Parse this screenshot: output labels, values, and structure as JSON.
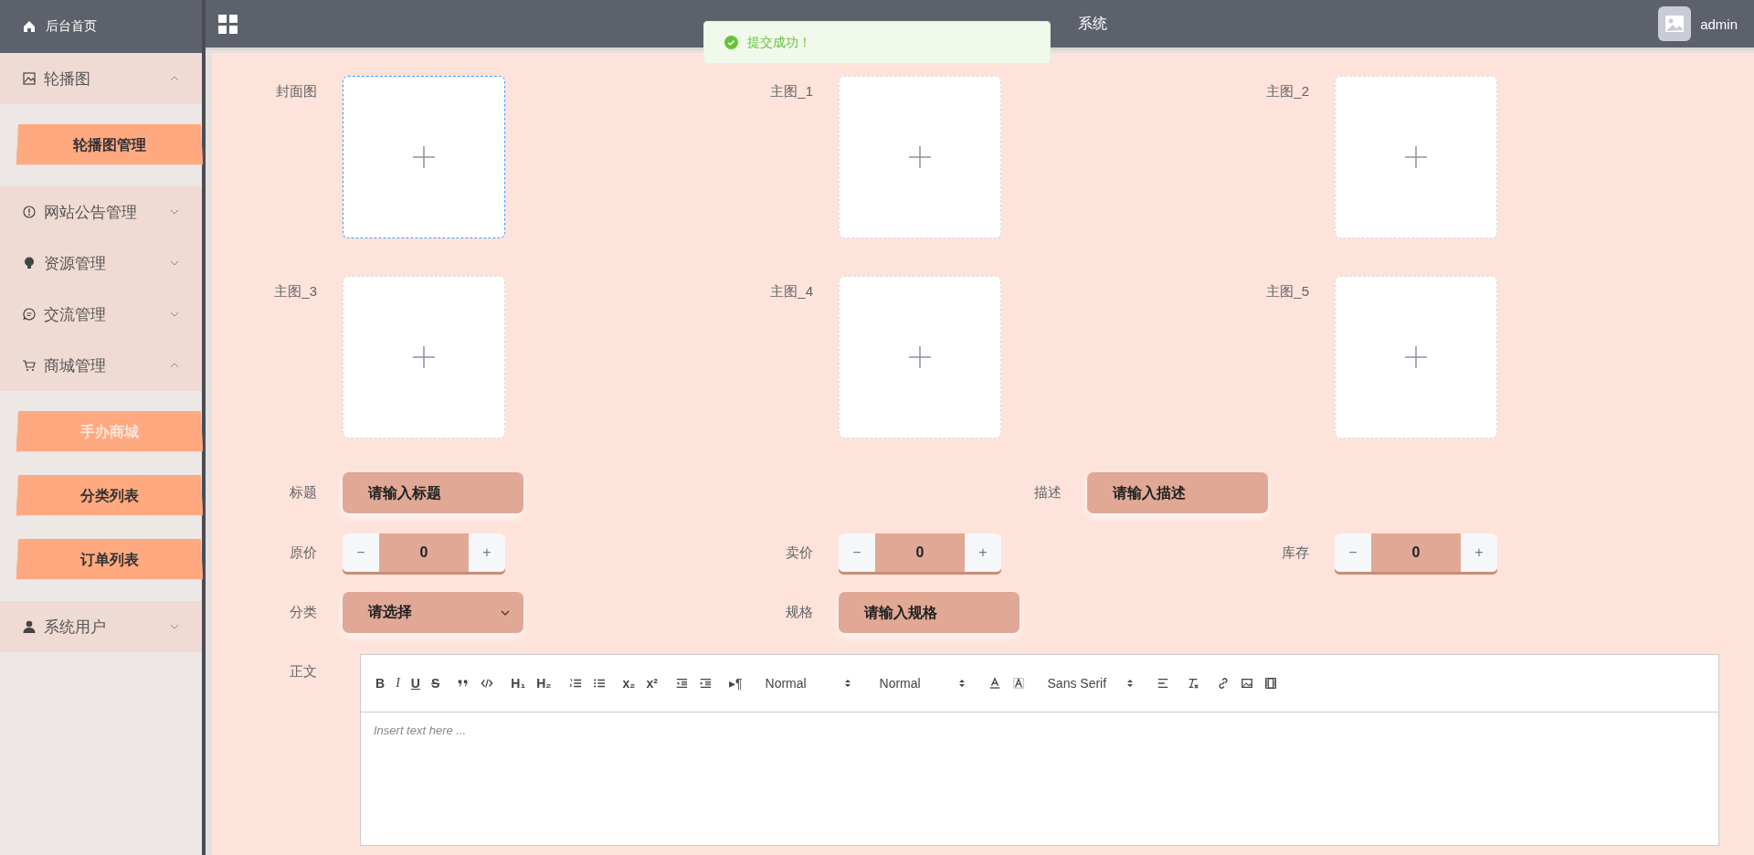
{
  "sidebar": {
    "home": "后台首页",
    "groups": [
      {
        "label": "轮播图",
        "expanded": true,
        "children": [
          {
            "label": "轮播图管理",
            "selected": false
          }
        ]
      },
      {
        "label": "网站公告管理",
        "expanded": false
      },
      {
        "label": "资源管理",
        "expanded": false
      },
      {
        "label": "交流管理",
        "expanded": false
      },
      {
        "label": "商城管理",
        "expanded": true,
        "children": [
          {
            "label": "手办商城",
            "selected": true
          },
          {
            "label": "分类列表",
            "selected": false
          },
          {
            "label": "订单列表",
            "selected": false
          }
        ]
      },
      {
        "label": "系统用户",
        "expanded": false
      }
    ]
  },
  "header": {
    "title": "系统",
    "user": "admin"
  },
  "toast": {
    "message": "提交成功！"
  },
  "uploads": [
    {
      "label": "封面图",
      "focused": true
    },
    {
      "label": "主图_1",
      "focused": false
    },
    {
      "label": "主图_2",
      "focused": false
    },
    {
      "label": "主图_3",
      "focused": false
    },
    {
      "label": "主图_4",
      "focused": false
    },
    {
      "label": "主图_5",
      "focused": false
    }
  ],
  "form_rows": [
    {
      "fields": [
        {
          "kind": "text",
          "label": "标题",
          "placeholder": "请输入标题"
        },
        {
          "kind": "text",
          "label": "描述",
          "placeholder": "请输入描述"
        }
      ]
    },
    {
      "fields": [
        {
          "kind": "number",
          "label": "原价",
          "value": "0",
          "minus": "−",
          "plus": "+"
        },
        {
          "kind": "number",
          "label": "卖价",
          "value": "0",
          "minus": "−",
          "plus": "+"
        },
        {
          "kind": "number",
          "label": "库存",
          "value": "0",
          "minus": "−",
          "plus": "+"
        }
      ]
    },
    {
      "fields": [
        {
          "kind": "select",
          "label": "分类",
          "placeholder": "请选择"
        },
        {
          "kind": "text",
          "label": "规格",
          "placeholder": "请输入规格"
        }
      ]
    }
  ],
  "editor": {
    "label": "正文",
    "placeholder": "Insert text here ...",
    "toolbar": [
      [
        {
          "kind": "bold",
          "text": "B"
        },
        {
          "kind": "italic",
          "text": "I"
        },
        {
          "kind": "underline",
          "text": "U"
        },
        {
          "kind": "strike",
          "text": "S"
        }
      ],
      [
        {
          "kind": "quote"
        },
        {
          "kind": "code"
        }
      ],
      [
        {
          "kind": "bold",
          "text": "H₁"
        },
        {
          "kind": "bold",
          "text": "H₂"
        }
      ],
      [
        {
          "kind": "ordered-list"
        },
        {
          "kind": "bullet-list"
        }
      ],
      [
        {
          "kind": "bold",
          "text": "x₂"
        },
        {
          "kind": "bold",
          "text": "x²"
        }
      ],
      [
        {
          "kind": "outdent"
        },
        {
          "kind": "indent"
        }
      ],
      [
        {
          "kind": "plain",
          "text": "▸¶"
        }
      ],
      [
        {
          "kind": "picker",
          "text": "Normal"
        }
      ],
      [
        {
          "kind": "picker",
          "text": "Normal"
        }
      ],
      [
        {
          "kind": "text-color"
        },
        {
          "kind": "background"
        }
      ],
      [
        {
          "kind": "picker",
          "text": "Sans Serif"
        }
      ],
      [
        {
          "kind": "align"
        }
      ],
      [
        {
          "kind": "clean"
        }
      ],
      [
        {
          "kind": "link"
        },
        {
          "kind": "image"
        },
        {
          "kind": "video"
        }
      ]
    ]
  }
}
